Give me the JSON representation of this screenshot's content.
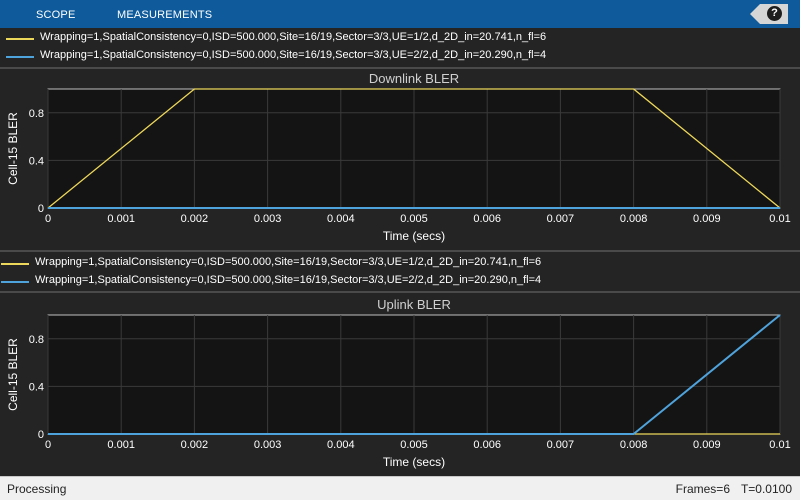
{
  "toolstrip": {
    "tabs": [
      {
        "label": "SCOPE"
      },
      {
        "label": "MEASUREMENTS"
      }
    ],
    "help_label": "?"
  },
  "colors": {
    "toolstrip": "#0e5a9b",
    "plot_bg": "#141414",
    "axes_frame": "#bfbfbf",
    "series_1": "#edd75a",
    "series_2": "#4fa3dc"
  },
  "legends": [
    {
      "entries": [
        {
          "label": "Wrapping=1,SpatialConsistency=0,ISD=500.000,Site=16/19,Sector=3/3,UE=1/2,d_2D_in=20.741,n_fl=6"
        },
        {
          "label": "Wrapping=1,SpatialConsistency=0,ISD=500.000,Site=16/19,Sector=3/3,UE=2/2,d_2D_in=20.290,n_fl=4"
        }
      ]
    },
    {
      "entries": [
        {
          "label": "Wrapping=1,SpatialConsistency=0,ISD=500.000,Site=16/19,Sector=3/3,UE=1/2,d_2D_in=20.741,n_fl=6"
        },
        {
          "label": "Wrapping=1,SpatialConsistency=0,ISD=500.000,Site=16/19,Sector=3/3,UE=2/2,d_2D_in=20.290,n_fl=4"
        }
      ]
    }
  ],
  "chart_data": [
    {
      "type": "line",
      "title": "Downlink BLER",
      "xlabel": "Time (secs)",
      "ylabel": "Cell-15 BLER",
      "xlim": [
        0,
        0.01
      ],
      "ylim": [
        0,
        1
      ],
      "xticks": [
        "0",
        "0.001",
        "0.002",
        "0.003",
        "0.004",
        "0.005",
        "0.006",
        "0.007",
        "0.008",
        "0.009",
        "0.01"
      ],
      "yticks": [
        "0",
        "0.4",
        "0.8"
      ],
      "grid": true,
      "series": [
        {
          "name": "Wrapping=1,SpatialConsistency=0,ISD=500.000,Site=16/19,Sector=3/3,UE=1/2,d_2D_in=20.741,n_fl=6",
          "color": "#edd75a",
          "x": [
            0,
            0.002,
            0.008,
            0.01
          ],
          "y": [
            0,
            1,
            1,
            0
          ]
        },
        {
          "name": "Wrapping=1,SpatialConsistency=0,ISD=500.000,Site=16/19,Sector=3/3,UE=2/2,d_2D_in=20.290,n_fl=4",
          "color": "#4fa3dc",
          "x": [
            0,
            0.01
          ],
          "y": [
            0,
            0
          ]
        }
      ]
    },
    {
      "type": "line",
      "title": "Uplink BLER",
      "xlabel": "Time (secs)",
      "ylabel": "Cell-15 BLER",
      "xlim": [
        0,
        0.01
      ],
      "ylim": [
        0,
        1
      ],
      "xticks": [
        "0",
        "0.001",
        "0.002",
        "0.003",
        "0.004",
        "0.005",
        "0.006",
        "0.007",
        "0.008",
        "0.009",
        "0.01"
      ],
      "yticks": [
        "0",
        "0.4",
        "0.8"
      ],
      "grid": true,
      "series": [
        {
          "name": "Wrapping=1,SpatialConsistency=0,ISD=500.000,Site=16/19,Sector=3/3,UE=1/2,d_2D_in=20.741,n_fl=6",
          "color": "#edd75a",
          "x": [
            0,
            0.01
          ],
          "y": [
            0,
            0
          ]
        },
        {
          "name": "Wrapping=1,SpatialConsistency=0,ISD=500.000,Site=16/19,Sector=3/3,UE=2/2,d_2D_in=20.290,n_fl=4",
          "color": "#4fa3dc",
          "x": [
            0,
            0.008,
            0.01
          ],
          "y": [
            0,
            0,
            1
          ]
        }
      ]
    }
  ],
  "status": {
    "state": "Processing",
    "frames": "Frames=6",
    "time": "T=0.0100"
  }
}
